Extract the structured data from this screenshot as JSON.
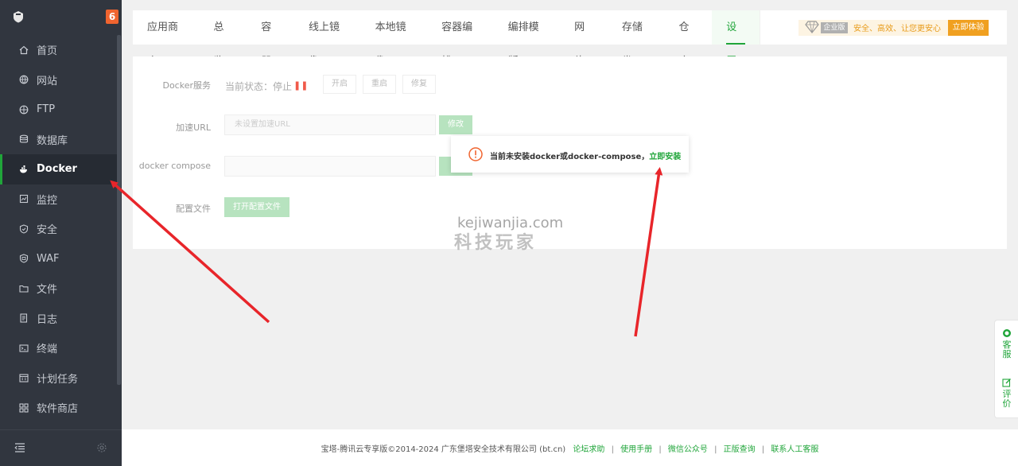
{
  "sidebar": {
    "badge": "6",
    "items": [
      {
        "label": "首页",
        "icon": "home-icon"
      },
      {
        "label": "网站",
        "icon": "globe-icon"
      },
      {
        "label": "FTP",
        "icon": "ftp-icon"
      },
      {
        "label": "数据库",
        "icon": "database-icon"
      },
      {
        "label": "Docker",
        "icon": "docker-icon",
        "active": true
      },
      {
        "label": "监控",
        "icon": "monitor-icon"
      },
      {
        "label": "安全",
        "icon": "shield-icon"
      },
      {
        "label": "WAF",
        "icon": "waf-icon"
      },
      {
        "label": "文件",
        "icon": "folder-icon"
      },
      {
        "label": "日志",
        "icon": "log-icon"
      },
      {
        "label": "终端",
        "icon": "terminal-icon"
      },
      {
        "label": "计划任务",
        "icon": "calendar-icon"
      },
      {
        "label": "软件商店",
        "icon": "grid-icon"
      }
    ]
  },
  "tabs": [
    "应用商店",
    "总览",
    "容器",
    "线上镜像",
    "本地镜像",
    "容器编排",
    "编排模版",
    "网络",
    "存储卷",
    "仓库",
    "设置"
  ],
  "active_tab": "设置",
  "promo": {
    "tag": "企业版",
    "text": "安全、高效、让您更安心",
    "button": "立即体验"
  },
  "settings": {
    "docker_service_label": "Docker服务",
    "status_text": "当前状态：停止",
    "start": "开启",
    "restart": "重启",
    "repair": "修复",
    "url_label": "加速URL",
    "url_placeholder": "未设置加速URL",
    "modify": "修改",
    "compose_label": "docker compose",
    "config_label": "配置文件",
    "open_config": "打开配置文件"
  },
  "toast": {
    "message": "当前未安装docker或docker-compose，",
    "link": "立即安装"
  },
  "watermark": {
    "line1": "kejiwanjia.com",
    "line2": "科技玩家"
  },
  "footer": {
    "copyright": "宝塔-腾讯云专享版©2014-2024 广东堡塔安全技术有限公司 (bt.cn)",
    "links": [
      "论坛求助",
      "使用手册",
      "微信公众号",
      "正版查询",
      "联系人工客服"
    ]
  },
  "float": {
    "service": "客服",
    "review": "评价"
  },
  "colors": {
    "accent": "#20a53a",
    "sidebar_bg": "#31363f",
    "badge": "#f0642f",
    "arrow": "#e8252a"
  }
}
